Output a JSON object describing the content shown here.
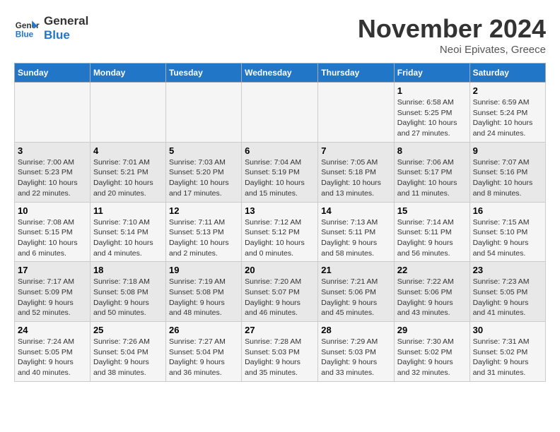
{
  "logo": {
    "line1": "General",
    "line2": "Blue"
  },
  "title": "November 2024",
  "subtitle": "Neoi Epivates, Greece",
  "weekdays": [
    "Sunday",
    "Monday",
    "Tuesday",
    "Wednesday",
    "Thursday",
    "Friday",
    "Saturday"
  ],
  "weeks": [
    [
      {
        "day": "",
        "info": ""
      },
      {
        "day": "",
        "info": ""
      },
      {
        "day": "",
        "info": ""
      },
      {
        "day": "",
        "info": ""
      },
      {
        "day": "",
        "info": ""
      },
      {
        "day": "1",
        "info": "Sunrise: 6:58 AM\nSunset: 5:25 PM\nDaylight: 10 hours and 27 minutes."
      },
      {
        "day": "2",
        "info": "Sunrise: 6:59 AM\nSunset: 5:24 PM\nDaylight: 10 hours and 24 minutes."
      }
    ],
    [
      {
        "day": "3",
        "info": "Sunrise: 7:00 AM\nSunset: 5:23 PM\nDaylight: 10 hours and 22 minutes."
      },
      {
        "day": "4",
        "info": "Sunrise: 7:01 AM\nSunset: 5:21 PM\nDaylight: 10 hours and 20 minutes."
      },
      {
        "day": "5",
        "info": "Sunrise: 7:03 AM\nSunset: 5:20 PM\nDaylight: 10 hours and 17 minutes."
      },
      {
        "day": "6",
        "info": "Sunrise: 7:04 AM\nSunset: 5:19 PM\nDaylight: 10 hours and 15 minutes."
      },
      {
        "day": "7",
        "info": "Sunrise: 7:05 AM\nSunset: 5:18 PM\nDaylight: 10 hours and 13 minutes."
      },
      {
        "day": "8",
        "info": "Sunrise: 7:06 AM\nSunset: 5:17 PM\nDaylight: 10 hours and 11 minutes."
      },
      {
        "day": "9",
        "info": "Sunrise: 7:07 AM\nSunset: 5:16 PM\nDaylight: 10 hours and 8 minutes."
      }
    ],
    [
      {
        "day": "10",
        "info": "Sunrise: 7:08 AM\nSunset: 5:15 PM\nDaylight: 10 hours and 6 minutes."
      },
      {
        "day": "11",
        "info": "Sunrise: 7:10 AM\nSunset: 5:14 PM\nDaylight: 10 hours and 4 minutes."
      },
      {
        "day": "12",
        "info": "Sunrise: 7:11 AM\nSunset: 5:13 PM\nDaylight: 10 hours and 2 minutes."
      },
      {
        "day": "13",
        "info": "Sunrise: 7:12 AM\nSunset: 5:12 PM\nDaylight: 10 hours and 0 minutes."
      },
      {
        "day": "14",
        "info": "Sunrise: 7:13 AM\nSunset: 5:11 PM\nDaylight: 9 hours and 58 minutes."
      },
      {
        "day": "15",
        "info": "Sunrise: 7:14 AM\nSunset: 5:11 PM\nDaylight: 9 hours and 56 minutes."
      },
      {
        "day": "16",
        "info": "Sunrise: 7:15 AM\nSunset: 5:10 PM\nDaylight: 9 hours and 54 minutes."
      }
    ],
    [
      {
        "day": "17",
        "info": "Sunrise: 7:17 AM\nSunset: 5:09 PM\nDaylight: 9 hours and 52 minutes."
      },
      {
        "day": "18",
        "info": "Sunrise: 7:18 AM\nSunset: 5:08 PM\nDaylight: 9 hours and 50 minutes."
      },
      {
        "day": "19",
        "info": "Sunrise: 7:19 AM\nSunset: 5:08 PM\nDaylight: 9 hours and 48 minutes."
      },
      {
        "day": "20",
        "info": "Sunrise: 7:20 AM\nSunset: 5:07 PM\nDaylight: 9 hours and 46 minutes."
      },
      {
        "day": "21",
        "info": "Sunrise: 7:21 AM\nSunset: 5:06 PM\nDaylight: 9 hours and 45 minutes."
      },
      {
        "day": "22",
        "info": "Sunrise: 7:22 AM\nSunset: 5:06 PM\nDaylight: 9 hours and 43 minutes."
      },
      {
        "day": "23",
        "info": "Sunrise: 7:23 AM\nSunset: 5:05 PM\nDaylight: 9 hours and 41 minutes."
      }
    ],
    [
      {
        "day": "24",
        "info": "Sunrise: 7:24 AM\nSunset: 5:05 PM\nDaylight: 9 hours and 40 minutes."
      },
      {
        "day": "25",
        "info": "Sunrise: 7:26 AM\nSunset: 5:04 PM\nDaylight: 9 hours and 38 minutes."
      },
      {
        "day": "26",
        "info": "Sunrise: 7:27 AM\nSunset: 5:04 PM\nDaylight: 9 hours and 36 minutes."
      },
      {
        "day": "27",
        "info": "Sunrise: 7:28 AM\nSunset: 5:03 PM\nDaylight: 9 hours and 35 minutes."
      },
      {
        "day": "28",
        "info": "Sunrise: 7:29 AM\nSunset: 5:03 PM\nDaylight: 9 hours and 33 minutes."
      },
      {
        "day": "29",
        "info": "Sunrise: 7:30 AM\nSunset: 5:02 PM\nDaylight: 9 hours and 32 minutes."
      },
      {
        "day": "30",
        "info": "Sunrise: 7:31 AM\nSunset: 5:02 PM\nDaylight: 9 hours and 31 minutes."
      }
    ]
  ]
}
